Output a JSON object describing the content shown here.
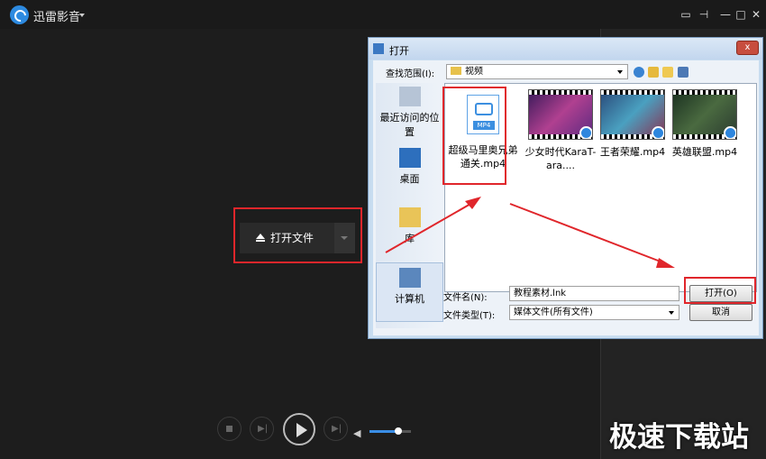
{
  "app": {
    "name": "迅雷影音"
  },
  "player": {
    "open_file_label": "打开文件"
  },
  "dialog": {
    "title": "打开",
    "close_label": "x",
    "look_in_label": "查找范围(I):",
    "look_in_value": "视频",
    "places": [
      {
        "label": "最近访问的位置"
      },
      {
        "label": "桌面"
      },
      {
        "label": "库"
      },
      {
        "label": "计算机"
      }
    ],
    "files": [
      {
        "name": "超级马里奥兄弟通关.mp4",
        "kind": "mp4-icon",
        "tag": "MP4"
      },
      {
        "name": "少女时代KaraT-ara....",
        "kind": "video-thumb"
      },
      {
        "name": "王者荣耀.mp4",
        "kind": "video-thumb"
      },
      {
        "name": "英雄联盟.mp4",
        "kind": "video-thumb"
      }
    ],
    "filename_label": "文件名(N):",
    "filename_value": "教程素材.lnk",
    "filetype_label": "文件类型(T):",
    "filetype_value": "媒体文件(所有文件)",
    "open_button": "打开(O)",
    "cancel_button": "取消"
  },
  "watermark": "极速下载站",
  "colors": {
    "accent": "#2d8ae0",
    "highlight_box": "#e0262b"
  }
}
